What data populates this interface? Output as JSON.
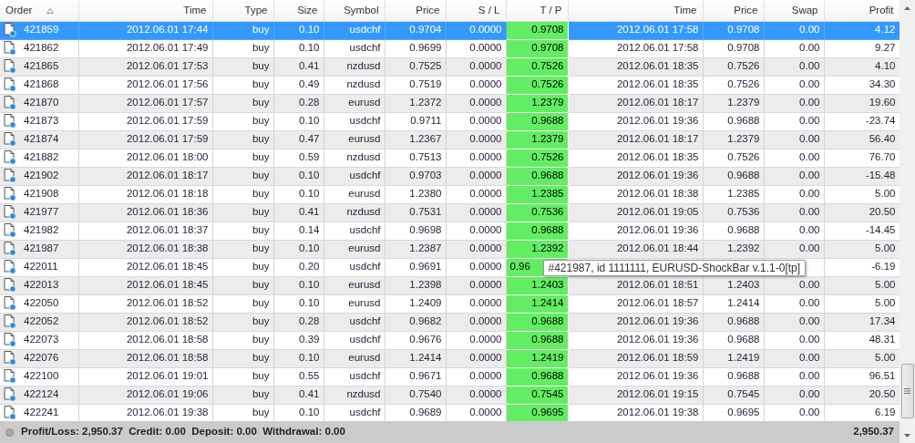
{
  "columns": [
    {
      "label": "Order",
      "sorted": true
    },
    {
      "label": "Time",
      "sorted": false
    },
    {
      "label": "Type",
      "sorted": false
    },
    {
      "label": "Size",
      "sorted": false
    },
    {
      "label": "Symbol",
      "sorted": false
    },
    {
      "label": "Price",
      "sorted": false
    },
    {
      "label": "S / L",
      "sorted": false
    },
    {
      "label": "T / P",
      "sorted": false
    },
    {
      "label": "Time",
      "sorted": false
    },
    {
      "label": "Price",
      "sorted": false
    },
    {
      "label": "Swap",
      "sorted": false
    },
    {
      "label": "Profit",
      "sorted": false
    }
  ],
  "rows": [
    {
      "selected": true,
      "order": "421859",
      "open_time": "2012.06.01 17:44",
      "type": "buy",
      "size": "0.10",
      "symbol": "usdchf",
      "price": "0.9704",
      "sl": "0.0000",
      "tp": "0.9708",
      "close_time": "2012.06.01 17:58",
      "close_price": "0.9708",
      "swap": "0.00",
      "profit": "4.12"
    },
    {
      "selected": false,
      "order": "421862",
      "open_time": "2012.06.01 17:49",
      "type": "buy",
      "size": "0.10",
      "symbol": "usdchf",
      "price": "0.9699",
      "sl": "0.0000",
      "tp": "0.9708",
      "close_time": "2012.06.01 17:58",
      "close_price": "0.9708",
      "swap": "0.00",
      "profit": "9.27"
    },
    {
      "selected": false,
      "order": "421865",
      "open_time": "2012.06.01 17:53",
      "type": "buy",
      "size": "0.41",
      "symbol": "nzdusd",
      "price": "0.7525",
      "sl": "0.0000",
      "tp": "0.7526",
      "close_time": "2012.06.01 18:35",
      "close_price": "0.7526",
      "swap": "0.00",
      "profit": "4.10"
    },
    {
      "selected": false,
      "order": "421868",
      "open_time": "2012.06.01 17:56",
      "type": "buy",
      "size": "0.49",
      "symbol": "nzdusd",
      "price": "0.7519",
      "sl": "0.0000",
      "tp": "0.7526",
      "close_time": "2012.06.01 18:35",
      "close_price": "0.7526",
      "swap": "0.00",
      "profit": "34.30"
    },
    {
      "selected": false,
      "order": "421870",
      "open_time": "2012.06.01 17:57",
      "type": "buy",
      "size": "0.28",
      "symbol": "eurusd",
      "price": "1.2372",
      "sl": "0.0000",
      "tp": "1.2379",
      "close_time": "2012.06.01 18:17",
      "close_price": "1.2379",
      "swap": "0.00",
      "profit": "19.60"
    },
    {
      "selected": false,
      "order": "421873",
      "open_time": "2012.06.01 17:59",
      "type": "buy",
      "size": "0.10",
      "symbol": "usdchf",
      "price": "0.9711",
      "sl": "0.0000",
      "tp": "0.9688",
      "close_time": "2012.06.01 19:36",
      "close_price": "0.9688",
      "swap": "0.00",
      "profit": "-23.74"
    },
    {
      "selected": false,
      "order": "421874",
      "open_time": "2012.06.01 17:59",
      "type": "buy",
      "size": "0.47",
      "symbol": "eurusd",
      "price": "1.2367",
      "sl": "0.0000",
      "tp": "1.2379",
      "close_time": "2012.06.01 18:17",
      "close_price": "1.2379",
      "swap": "0.00",
      "profit": "56.40"
    },
    {
      "selected": false,
      "order": "421882",
      "open_time": "2012.06.01 18:00",
      "type": "buy",
      "size": "0.59",
      "symbol": "nzdusd",
      "price": "0.7513",
      "sl": "0.0000",
      "tp": "0.7526",
      "close_time": "2012.06.01 18:35",
      "close_price": "0.7526",
      "swap": "0.00",
      "profit": "76.70"
    },
    {
      "selected": false,
      "order": "421902",
      "open_time": "2012.06.01 18:17",
      "type": "buy",
      "size": "0.10",
      "symbol": "usdchf",
      "price": "0.9703",
      "sl": "0.0000",
      "tp": "0.9688",
      "close_time": "2012.06.01 19:36",
      "close_price": "0.9688",
      "swap": "0.00",
      "profit": "-15.48"
    },
    {
      "selected": false,
      "order": "421908",
      "open_time": "2012.06.01 18:18",
      "type": "buy",
      "size": "0.10",
      "symbol": "eurusd",
      "price": "1.2380",
      "sl": "0.0000",
      "tp": "1.2385",
      "close_time": "2012.06.01 18:38",
      "close_price": "1.2385",
      "swap": "0.00",
      "profit": "5.00"
    },
    {
      "selected": false,
      "order": "421977",
      "open_time": "2012.06.01 18:36",
      "type": "buy",
      "size": "0.41",
      "symbol": "nzdusd",
      "price": "0.7531",
      "sl": "0.0000",
      "tp": "0.7536",
      "close_time": "2012.06.01 19:05",
      "close_price": "0.7536",
      "swap": "0.00",
      "profit": "20.50"
    },
    {
      "selected": false,
      "order": "421982",
      "open_time": "2012.06.01 18:37",
      "type": "buy",
      "size": "0.14",
      "symbol": "usdchf",
      "price": "0.9698",
      "sl": "0.0000",
      "tp": "0.9688",
      "close_time": "2012.06.01 19:36",
      "close_price": "0.9688",
      "swap": "0.00",
      "profit": "-14.45"
    },
    {
      "selected": false,
      "order": "421987",
      "open_time": "2012.06.01 18:38",
      "type": "buy",
      "size": "0.10",
      "symbol": "eurusd",
      "price": "1.2387",
      "sl": "0.0000",
      "tp": "1.2392",
      "close_time": "2012.06.01 18:44",
      "close_price": "1.2392",
      "swap": "0.00",
      "profit": "5.00"
    },
    {
      "selected": false,
      "order": "422011",
      "open_time": "2012.06.01 18:45",
      "type": "buy",
      "size": "0.20",
      "symbol": "usdchf",
      "price": "0.9691",
      "sl": "0.0000",
      "tp": "0.96",
      "profit": "-6.19",
      "tooltip": "#421987, id 1111111, EURUSD-ShockBar v.1.1-0[tp]"
    },
    {
      "selected": false,
      "order": "422013",
      "open_time": "2012.06.01 18:45",
      "type": "buy",
      "size": "0.10",
      "symbol": "eurusd",
      "price": "1.2398",
      "sl": "0.0000",
      "tp": "1.2403",
      "close_time": "2012.06.01 18:51",
      "close_price": "1.2403",
      "swap": "0.00",
      "profit": "5.00"
    },
    {
      "selected": false,
      "order": "422050",
      "open_time": "2012.06.01 18:52",
      "type": "buy",
      "size": "0.10",
      "symbol": "eurusd",
      "price": "1.2409",
      "sl": "0.0000",
      "tp": "1.2414",
      "close_time": "2012.06.01 18:57",
      "close_price": "1.2414",
      "swap": "0.00",
      "profit": "5.00"
    },
    {
      "selected": false,
      "order": "422052",
      "open_time": "2012.06.01 18:52",
      "type": "buy",
      "size": "0.28",
      "symbol": "usdchf",
      "price": "0.9682",
      "sl": "0.0000",
      "tp": "0.9688",
      "close_time": "2012.06.01 19:36",
      "close_price": "0.9688",
      "swap": "0.00",
      "profit": "17.34"
    },
    {
      "selected": false,
      "order": "422073",
      "open_time": "2012.06.01 18:58",
      "type": "buy",
      "size": "0.39",
      "symbol": "usdchf",
      "price": "0.9676",
      "sl": "0.0000",
      "tp": "0.9688",
      "close_time": "2012.06.01 19:36",
      "close_price": "0.9688",
      "swap": "0.00",
      "profit": "48.31"
    },
    {
      "selected": false,
      "order": "422076",
      "open_time": "2012.06.01 18:58",
      "type": "buy",
      "size": "0.10",
      "symbol": "eurusd",
      "price": "1.2414",
      "sl": "0.0000",
      "tp": "1.2419",
      "close_time": "2012.06.01 18:59",
      "close_price": "1.2419",
      "swap": "0.00",
      "profit": "5.00"
    },
    {
      "selected": false,
      "order": "422100",
      "open_time": "2012.06.01 19:01",
      "type": "buy",
      "size": "0.55",
      "symbol": "usdchf",
      "price": "0.9671",
      "sl": "0.0000",
      "tp": "0.9688",
      "close_time": "2012.06.01 19:36",
      "close_price": "0.9688",
      "swap": "0.00",
      "profit": "96.51"
    },
    {
      "selected": false,
      "order": "422124",
      "open_time": "2012.06.01 19:06",
      "type": "buy",
      "size": "0.41",
      "symbol": "nzdusd",
      "price": "0.7540",
      "sl": "0.0000",
      "tp": "0.7545",
      "close_time": "2012.06.01 19:15",
      "close_price": "0.7545",
      "swap": "0.00",
      "profit": "20.50"
    },
    {
      "selected": false,
      "order": "422241",
      "open_time": "2012.06.01 19:38",
      "type": "buy",
      "size": "0.10",
      "symbol": "usdchf",
      "price": "0.9689",
      "sl": "0.0000",
      "tp": "0.9695",
      "close_time": "2012.06.01 19:38",
      "close_price": "0.9695",
      "swap": "0.00",
      "profit": "6.19"
    }
  ],
  "status_bar": {
    "summary": "Profit/Loss: 2,950.37  Credit: 0.00  Deposit: 0.00  Withdrawal: 0.00",
    "total": "2,950.37"
  }
}
